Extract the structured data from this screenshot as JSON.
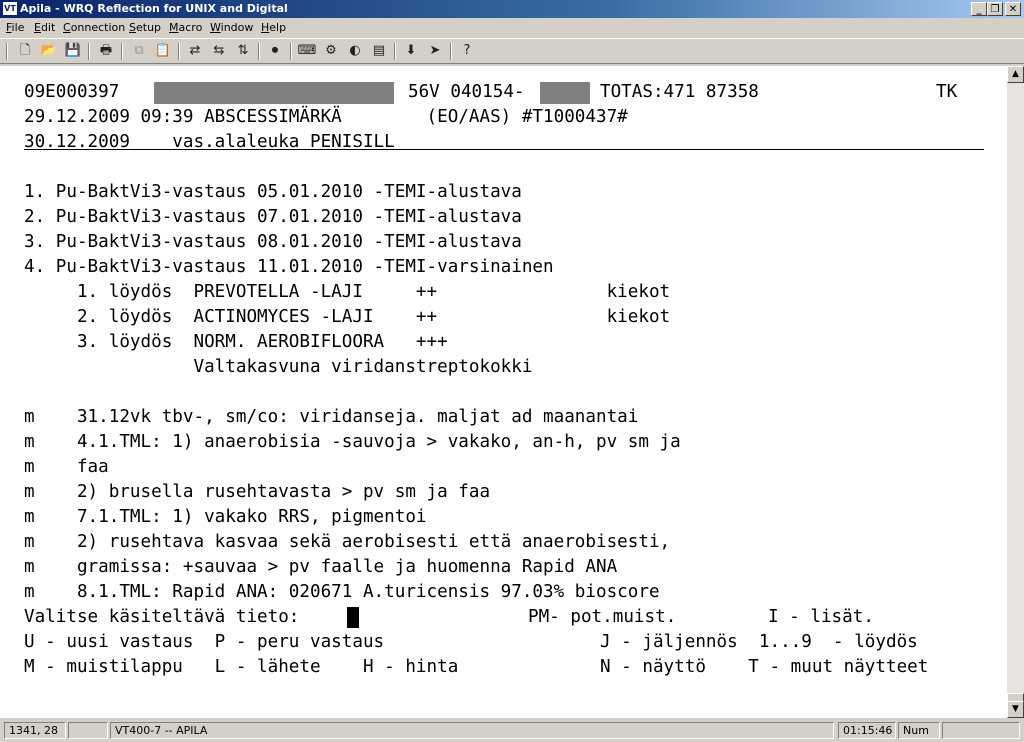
{
  "window": {
    "app_icon_text": "VT",
    "title": "Apila - WRQ Reflection for UNIX and Digital",
    "controls": {
      "minimize": "_",
      "restore": "❐",
      "close": "✕"
    }
  },
  "menu": [
    "File",
    "Edit",
    "Connection",
    "Setup",
    "Macro",
    "Window",
    "Help"
  ],
  "toolbar": {
    "new_icon": "🗋",
    "open_icon": "📂",
    "save_icon": "💾",
    "print_icon": "🖶",
    "copy_icon": "⧉",
    "paste_icon": "📋",
    "connect_icon": "⇄",
    "disconnect_icon": "⇆",
    "transfer_icon": "⇅",
    "macro_icon": "⏺",
    "keyboard_icon": "⌨",
    "settings_icon": "⚙",
    "color_icon": "◐",
    "terminal_icon": "▤",
    "download_icon": "⬇",
    "run_icon": "➤",
    "help_icon": "?"
  },
  "terminal": {
    "header": {
      "row1_left": "09E000397",
      "row1_mid": "56V 040154-",
      "row1_right": "TOTAS:471 87358",
      "row1_tag": "TK",
      "row2": "29.12.2009 09:39 ABSCESSIMÄRKÄ        (EO/AAS) #T1000437#",
      "row3": "30.12.2009    vas.alaleuka PENISILL"
    },
    "results": [
      "1. Pu-BaktVi3-vastaus 05.01.2010 -TEMI-alustava",
      "2. Pu-BaktVi3-vastaus 07.01.2010 -TEMI-alustava",
      "3. Pu-BaktVi3-vastaus 08.01.2010 -TEMI-alustava",
      "4. Pu-BaktVi3-vastaus 11.01.2010 -TEMI-varsinainen"
    ],
    "findings": [
      "     1. löydös  PREVOTELLA -LAJI     ++                kiekot",
      "     2. löydös  ACTINOMYCES -LAJI    ++                kiekot",
      "     3. löydös  NORM. AEROBIFLOORA   +++",
      "                Valtakasvuna viridanstreptokokki"
    ],
    "notes": [
      "m    31.12vk tbv-, sm/co: viridanseja. maljat ad maanantai",
      "m    4.1.TML: 1) anaerobisia -sauvoja > vakako, an-h, pv sm ja",
      "m    faa",
      "m    2) brusella rusehtavasta > pv sm ja faa",
      "m    7.1.TML: 1) vakako RRS, pigmentoi",
      "m    2) rusehtava kasvaa sekä aerobisesti että anaerobisesti,",
      "m    gramissa: +sauvaa > pv faalle ja huomenna Rapid ANA",
      "m    8.1.TML: Rapid ANA: 020671 A.turicensis 97.03% bioscore"
    ],
    "prompt": {
      "label": "Valitse käsiteltävä tieto:",
      "pm": "PM- pot.muist.",
      "lisat": "I - lisät."
    },
    "commands_row1": {
      "left": "U - uusi vastaus  P - peru vastaus",
      "right": "J - jäljennös  1...9  - löydös"
    },
    "commands_row2": {
      "left": "M - muistilappu   L - lähete    H - hinta",
      "right": "N - näyttö    T - muut näytteet"
    }
  },
  "scrollbar": {
    "up_arrow": "▲",
    "down_arrow": "▼"
  },
  "status": {
    "cursor_pos": "1341, 28",
    "terminal_type": "VT400-7 -- APILA",
    "time": "01:15:46",
    "num": "Num"
  }
}
